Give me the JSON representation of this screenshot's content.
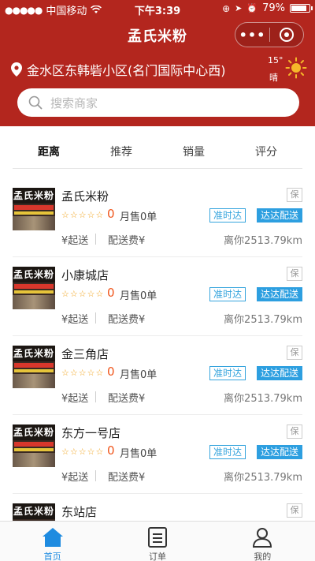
{
  "status": {
    "carrier": "中国移动",
    "time": "下午3:39",
    "battery": "79%",
    "battery_level": 0.79
  },
  "nav": {
    "title": "孟氏米粉",
    "more": "•••"
  },
  "location": {
    "address": "金水区东韩砦小区(名门国际中心西)"
  },
  "weather": {
    "temp": "15°",
    "condition": "晴"
  },
  "search": {
    "placeholder": "搜索商家"
  },
  "tabs": [
    "距离",
    "推荐",
    "销量",
    "评分"
  ],
  "thumb_sign": "孟氏米粉",
  "shops": [
    {
      "name": "孟氏米粉",
      "score": "0",
      "sales": "月售0单",
      "tag1": "准时达",
      "tag2": "达达配送",
      "min": "¥起送",
      "fee": "配送费¥",
      "distance": "离你2513.79km",
      "badge": "保"
    },
    {
      "name": "小康城店",
      "score": "0",
      "sales": "月售0单",
      "tag1": "准时达",
      "tag2": "达达配送",
      "min": "¥起送",
      "fee": "配送费¥",
      "distance": "离你2513.79km",
      "badge": "保"
    },
    {
      "name": "金三角店",
      "score": "0",
      "sales": "月售0单",
      "tag1": "准时达",
      "tag2": "达达配送",
      "min": "¥起送",
      "fee": "配送费¥",
      "distance": "离你2513.79km",
      "badge": "保"
    },
    {
      "name": "东方一号店",
      "score": "0",
      "sales": "月售0单",
      "tag1": "准时达",
      "tag2": "达达配送",
      "min": "¥起送",
      "fee": "配送费¥",
      "distance": "离你2513.79km",
      "badge": "保"
    },
    {
      "name": "东站店",
      "score": "",
      "sales": "",
      "tag1": "",
      "tag2": "",
      "min": "",
      "fee": "",
      "distance": "",
      "badge": "保"
    }
  ],
  "tabbar": [
    {
      "label": "首页",
      "icon": "home-icon",
      "active": true
    },
    {
      "label": "订单",
      "icon": "order-icon",
      "active": false
    },
    {
      "label": "我的",
      "icon": "profile-icon",
      "active": false
    }
  ],
  "colors": {
    "brand": "#b3261e",
    "accent": "#1e8be0",
    "score": "#f0561c",
    "star": "#f1a21a"
  }
}
